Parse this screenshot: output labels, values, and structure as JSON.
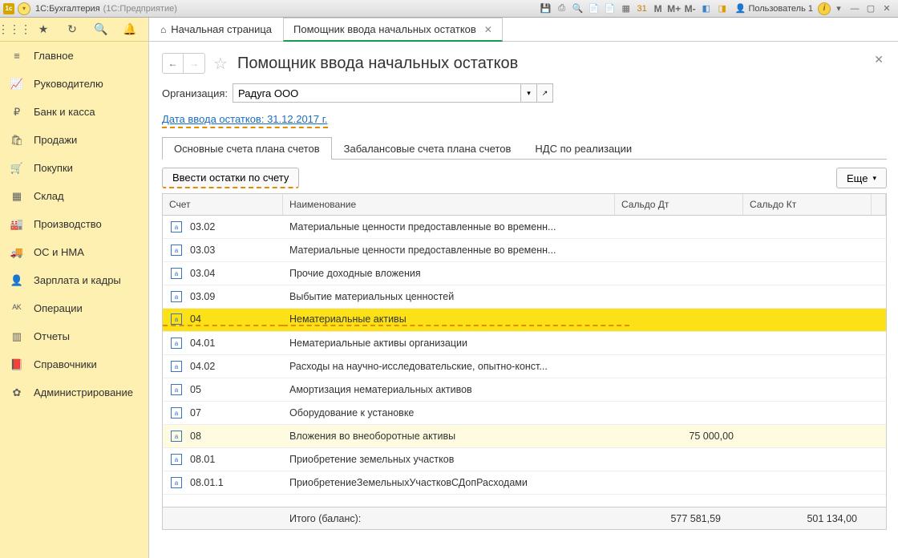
{
  "titlebar": {
    "app_badge": "1c",
    "title": "1С:Бухгалтерия",
    "subtitle": "(1С:Предприятие)",
    "m1": "M",
    "m2": "M+",
    "m3": "M-",
    "user": "Пользователь 1"
  },
  "rail": {
    "items": [
      {
        "icon": "≡",
        "label": "Главное"
      },
      {
        "icon": "📈",
        "label": "Руководителю"
      },
      {
        "icon": "₽",
        "label": "Банк и касса"
      },
      {
        "icon": "🛍",
        "label": "Продажи"
      },
      {
        "icon": "🛒",
        "label": "Покупки"
      },
      {
        "icon": "▦",
        "label": "Склад"
      },
      {
        "icon": "🏭",
        "label": "Производство"
      },
      {
        "icon": "🚚",
        "label": "ОС и НМА"
      },
      {
        "icon": "👤",
        "label": "Зарплата и кадры"
      },
      {
        "icon": "ᴬᴷ",
        "label": "Операции"
      },
      {
        "icon": "▥",
        "label": "Отчеты"
      },
      {
        "icon": "📕",
        "label": "Справочники"
      },
      {
        "icon": "✿",
        "label": "Администрирование"
      }
    ]
  },
  "tabs": {
    "home": "Начальная страница",
    "page": "Помощник ввода начальных остатков"
  },
  "page": {
    "title": "Помощник ввода начальных остатков",
    "org_label": "Организация:",
    "org_value": "Радуга ООО",
    "date_link": "Дата ввода остатков: 31.12.2017 г."
  },
  "subtabs": {
    "t1": "Основные счета плана счетов",
    "t2": "Забалансовые счета плана счетов",
    "t3": "НДС по реализации"
  },
  "toolbar": {
    "enter_btn": "Ввести остатки по счету",
    "more_btn": "Еще"
  },
  "table": {
    "headers": {
      "acc": "Счет",
      "name": "Наименование",
      "dt": "Сальдо Дт",
      "kt": "Сальдо Кт"
    },
    "rows": [
      {
        "acc": "03.02",
        "name": "Материальные ценности предоставленные во временн...",
        "dt": "",
        "kt": "",
        "cls": ""
      },
      {
        "acc": "03.03",
        "name": "Материальные ценности предоставленные во временн...",
        "dt": "",
        "kt": "",
        "cls": ""
      },
      {
        "acc": "03.04",
        "name": "Прочие доходные вложения",
        "dt": "",
        "kt": "",
        "cls": ""
      },
      {
        "acc": "03.09",
        "name": "Выбытие материальных ценностей",
        "dt": "",
        "kt": "",
        "cls": ""
      },
      {
        "acc": "04",
        "name": "Нематериальные активы",
        "dt": "",
        "kt": "",
        "cls": "hl"
      },
      {
        "acc": "04.01",
        "name": "Нематериальные активы организации",
        "dt": "",
        "kt": "",
        "cls": ""
      },
      {
        "acc": "04.02",
        "name": "Расходы на научно-исследовательские, опытно-конст...",
        "dt": "",
        "kt": "",
        "cls": ""
      },
      {
        "acc": "05",
        "name": "Амортизация нематериальных активов",
        "dt": "",
        "kt": "",
        "cls": ""
      },
      {
        "acc": "07",
        "name": "Оборудование к установке",
        "dt": "",
        "kt": "",
        "cls": ""
      },
      {
        "acc": "08",
        "name": "Вложения во внеоборотные активы",
        "dt": "75 000,00",
        "kt": "",
        "cls": "soft"
      },
      {
        "acc": "08.01",
        "name": "Приобретение земельных участков",
        "dt": "",
        "kt": "",
        "cls": ""
      },
      {
        "acc": "08.01.1",
        "name": "ПриобретениеЗемельныхУчастковСДопРасходами",
        "dt": "",
        "kt": "",
        "cls": ""
      }
    ],
    "footer": {
      "label": "Итого (баланс):",
      "dt": "577 581,59",
      "kt": "501 134,00"
    }
  }
}
